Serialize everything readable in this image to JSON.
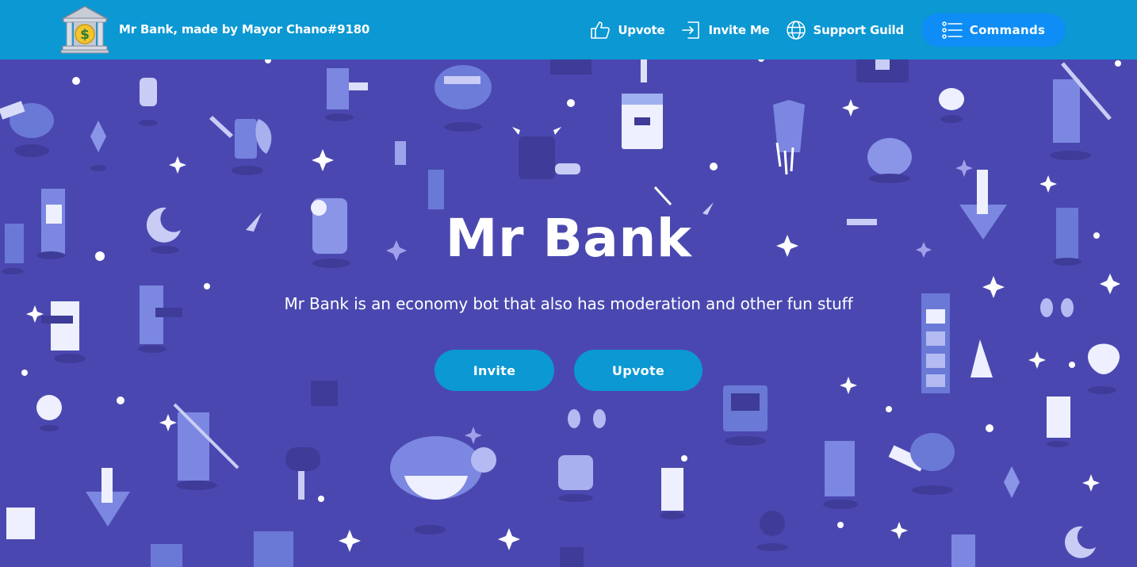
{
  "navbar": {
    "brand_text": "Mr Bank, made by Mayor Chano#9180",
    "logo_icon": "bank-dollar-icon",
    "links": [
      {
        "label": "Upvote",
        "icon": "thumbs-up-icon"
      },
      {
        "label": "Invite Me",
        "icon": "sign-in-icon"
      },
      {
        "label": "Support Guild",
        "icon": "globe-icon"
      }
    ],
    "commands_label": "Commands",
    "commands_icon": "list-icon"
  },
  "hero": {
    "title": "Mr Bank",
    "subtitle": "Mr Bank is an economy bot that also has moderation and other fun stuff",
    "invite_label": "Invite",
    "upvote_label": "Upvote"
  },
  "colors": {
    "navbar": "#0b98d3",
    "background": "#4a48b0",
    "commands_button": "#0d8df5",
    "hero_button": "#0b98d3"
  }
}
